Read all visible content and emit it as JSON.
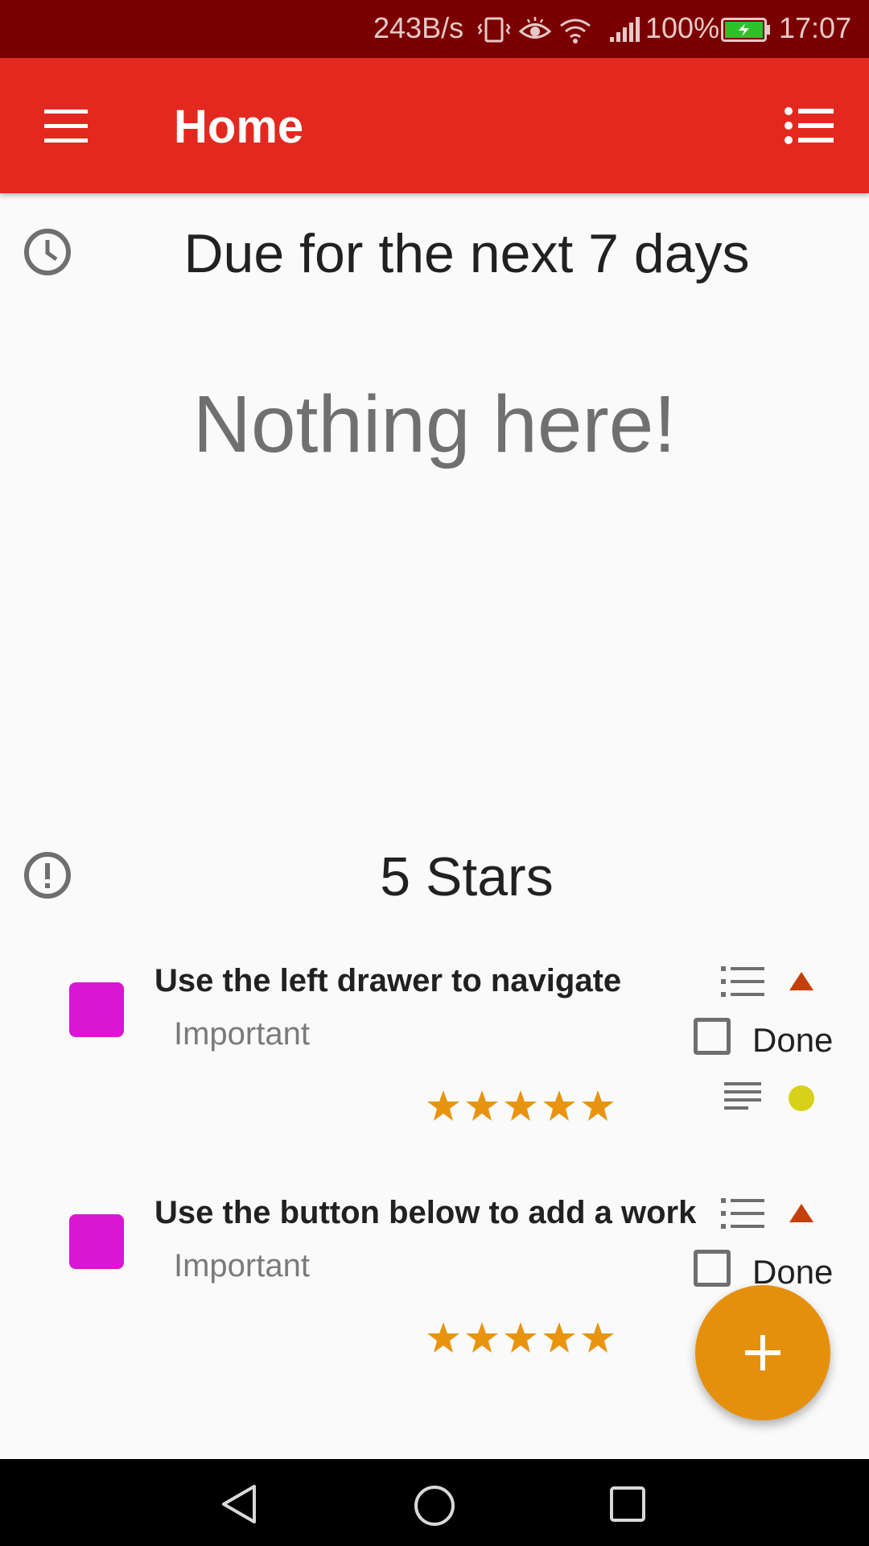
{
  "status_bar": {
    "speed": "243B/s",
    "battery": "100%",
    "time": "17:07"
  },
  "app_bar": {
    "title": "Home"
  },
  "due_section": {
    "title": "Due for the next 7 days",
    "empty_message": "Nothing here!"
  },
  "stars_section": {
    "title": "5 Stars",
    "items": [
      {
        "title": "Use the left drawer to navigate",
        "category": "Important",
        "rating": 5,
        "done_label": "Done",
        "swatch_color": "#d916d4"
      },
      {
        "title": "Use the button below to add a work",
        "category": "Important",
        "rating": 5,
        "done_label": "Done",
        "swatch_color": "#d916d4"
      }
    ]
  },
  "colors": {
    "status_bar": "#7a0000",
    "app_bar": "#e3291f",
    "fab": "#e5900d",
    "star": "#e89410",
    "priority_up": "#c4400b",
    "note_dot": "#d8d11a"
  },
  "icons": {
    "menu": "hamburger-menu-icon",
    "view": "list-view-icon",
    "due": "clock-icon",
    "stars": "alert-circle-icon",
    "fab": "plus-icon"
  }
}
